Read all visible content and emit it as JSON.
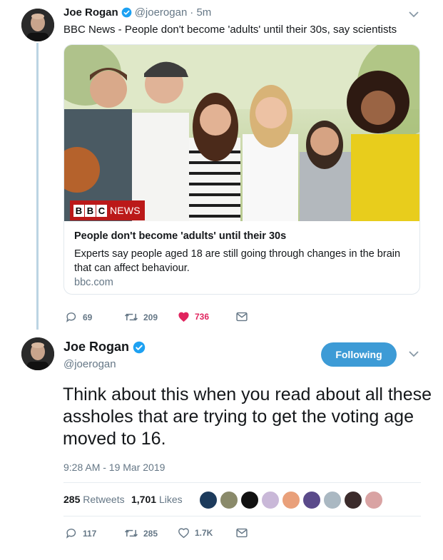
{
  "quoted_tweet": {
    "name": "Joe Rogan",
    "handle": "@joerogan",
    "time": "· 5m",
    "text": "BBC News - People don't become 'adults' until their 30s, say scientists",
    "card": {
      "source_logo": [
        "B",
        "B",
        "C"
      ],
      "source_word": "NEWS",
      "title": "People don't become 'adults' until their 30s",
      "description": "Experts say people aged 18 are still going through changes in the brain that can affect behaviour.",
      "domain": "bbc.com"
    },
    "actions": {
      "replies": "69",
      "retweets": "209",
      "likes": "736"
    }
  },
  "main_tweet": {
    "name": "Joe Rogan",
    "handle": "@joerogan",
    "follow_label": "Following",
    "text": "Think about this when you read about all these assholes that are trying to get the voting age moved to 16.",
    "timestamp": "9:28 AM - 19 Mar 2019",
    "stats": {
      "retweets_count": "285",
      "retweets_label": "Retweets",
      "likes_count": "1,701",
      "likes_label": "Likes"
    },
    "actions": {
      "replies": "117",
      "retweets": "285",
      "likes": "1.7K"
    }
  },
  "colors": {
    "accent": "#1da1f2",
    "follow_button": "#3d9bd6",
    "like_active": "#e0245e",
    "bbc_red": "#bb1919",
    "muted": "#657786"
  },
  "icons": [
    "verified-badge-icon",
    "chevron-down-icon",
    "reply-icon",
    "retweet-icon",
    "heart-icon",
    "message-icon"
  ]
}
